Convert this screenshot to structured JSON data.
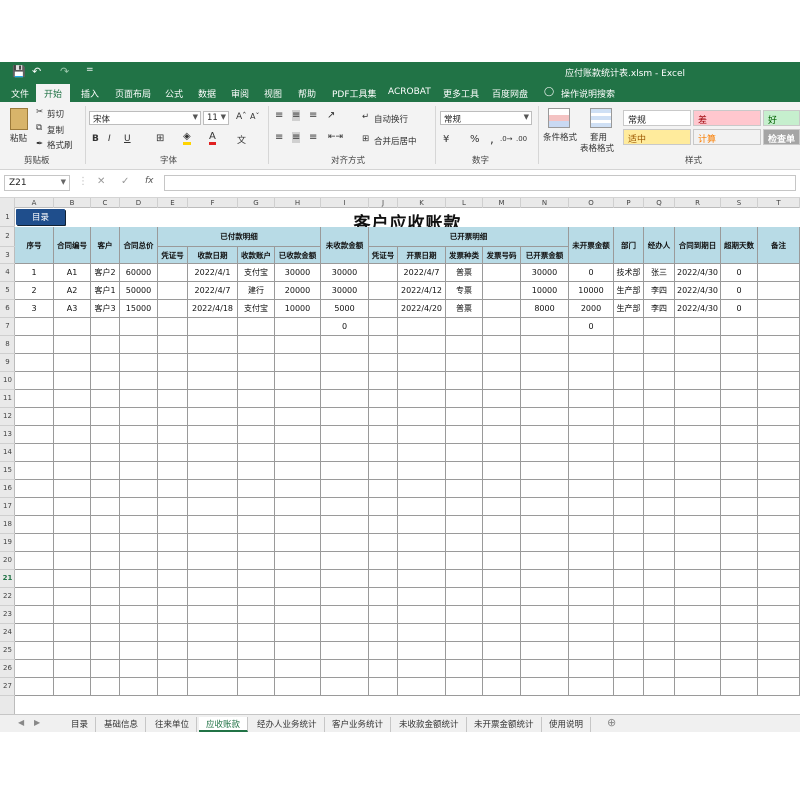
{
  "window": {
    "title": "应付账款统计表.xlsm  -  Excel",
    "quick_access": [
      "💾",
      "↶",
      "↷",
      "="
    ]
  },
  "ribbon_tabs": [
    "文件",
    "开始",
    "插入",
    "页面布局",
    "公式",
    "数据",
    "审阅",
    "视图",
    "帮助",
    "PDF工具集",
    "ACROBAT",
    "更多工具",
    "百度网盘",
    "操作说明搜索"
  ],
  "active_tab": "开始",
  "ribbon": {
    "paste": "粘贴",
    "cut": "剪切",
    "copy": "复制",
    "format_painter": "格式刷",
    "clipboard_group": "剪贴板",
    "font_name": "宋体",
    "font_size": "11",
    "font_group": "字体",
    "bold": "B",
    "italic": "I",
    "underline": "U",
    "wrap_text": "自动换行",
    "merge_center": "合并后居中",
    "alignment_group": "对齐方式",
    "number_format": "常规",
    "number_group": "数字",
    "cond_format": "条件格式",
    "table_format": "套用\n表格格式",
    "styles_group": "样式",
    "style_normal": "常规",
    "style_bad": "差",
    "style_good": "好",
    "style_neutral": "适中",
    "style_calc": "计算",
    "style_check": "检查单",
    "percent": "%",
    "comma": ","
  },
  "formula_bar": {
    "name_box": "Z21",
    "cancel": "✕",
    "enter": "✓",
    "fx": "fx"
  },
  "columns": [
    "A",
    "B",
    "C",
    "D",
    "E",
    "F",
    "G",
    "H",
    "I",
    "J",
    "K",
    "L",
    "M",
    "N",
    "O",
    "P",
    "Q",
    "R",
    "S",
    "T"
  ],
  "rows": [
    "1",
    "2",
    "3",
    "4",
    "5",
    "6",
    "7",
    "8",
    "9",
    "10",
    "11",
    "12",
    "13",
    "14",
    "15",
    "16",
    "17",
    "18",
    "19",
    "20",
    "21",
    "22",
    "23",
    "24",
    "25",
    "26",
    "27"
  ],
  "selected_row": "21",
  "sheet": {
    "title": "客户应收账款",
    "mulu_button": "目录",
    "group_headers": {
      "paid": "已付款明细",
      "invoiced": "已开票明细"
    },
    "headers": {
      "seq": "序号",
      "contract_no": "合同编号",
      "customer": "客户",
      "contract_total": "合同总价",
      "voucher1": "凭证号",
      "receive_date": "收款日期",
      "receive_account": "收款账户",
      "received_amount": "已收款金额",
      "unreceived": "未收款金额",
      "voucher2": "凭证号",
      "invoice_date": "开票日期",
      "invoice_type": "发票种类",
      "invoice_no": "发票号码",
      "invoiced_amount": "已开票金额",
      "uninvoiced": "未开票金额",
      "dept": "部门",
      "handler": "经办人",
      "due_date": "合同到期日",
      "overdue_days": "超期天数",
      "remark": "备注"
    },
    "data_rows": [
      [
        "1",
        "A1",
        "客户2",
        "60000",
        "",
        "2022/4/1",
        "支付宝",
        "30000",
        "30000",
        "",
        "2022/4/7",
        "普票",
        "",
        "30000",
        "0",
        "技术部",
        "张三",
        "2022/4/30",
        "0",
        ""
      ],
      [
        "2",
        "A2",
        "客户1",
        "50000",
        "",
        "2022/4/7",
        "建行",
        "20000",
        "30000",
        "",
        "2022/4/12",
        "专票",
        "",
        "10000",
        "10000",
        "生产部",
        "李四",
        "2022/4/30",
        "0",
        ""
      ],
      [
        "3",
        "A3",
        "客户3",
        "15000",
        "",
        "2022/4/18",
        "支付宝",
        "10000",
        "5000",
        "",
        "2022/4/20",
        "普票",
        "",
        "8000",
        "2000",
        "生产部",
        "李四",
        "2022/4/30",
        "0",
        ""
      ],
      [
        "",
        "",
        "",
        "",
        "",
        "",
        "",
        "",
        "0",
        "",
        "",
        "",
        "",
        "",
        "0",
        "",
        "",
        "",
        "",
        ""
      ]
    ]
  },
  "sheet_tabs": [
    "目录",
    "基础信息",
    "往来单位",
    "应收账款",
    "经办人业务统计",
    "客户业务统计",
    "未收款金额统计",
    "未开票金额统计",
    "使用说明"
  ],
  "active_sheet": "应收账款",
  "add_sheet": "⊕",
  "colors": {
    "excel_green": "#217346",
    "header_fill": "#b8dbe6",
    "mulu_blue": "#1f4e8c",
    "style_bad": "#ffc7ce",
    "style_good": "#c6efce",
    "style_neutral": "#ffeb9c",
    "style_calc": "#f2f2f2",
    "style_check": "#a5a5a5"
  }
}
